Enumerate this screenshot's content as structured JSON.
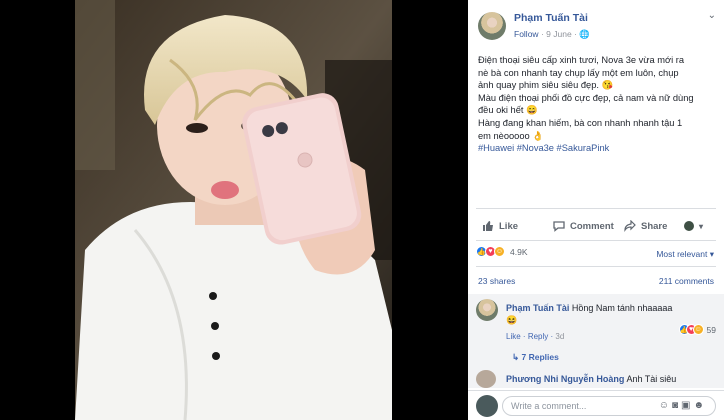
{
  "post": {
    "author": "Phạm Tuấn Tài",
    "follow": "Follow",
    "dot": "·",
    "date": "9 June",
    "caption_lines": [
      "Điện thoại siêu cấp xinh tươi, Nova 3e vừa mới ra",
      "nè bà con nhanh tay chụp lấy một em luôn, chụp",
      "ảnh quay phim siêu siêu đẹp. 😘",
      "Màu điện thoại phối đồ cực đẹp, cả nam và nữ dùng",
      "đều oki hết 😄",
      "Hàng đang khan hiếm, bà con nhanh nhanh tậu 1",
      "em nèooooo 👌"
    ],
    "hashtags": "#Huawei #Nova3e #SakuraPink"
  },
  "actions": {
    "like": "Like",
    "comment": "Comment",
    "share": "Share"
  },
  "reactions": {
    "count": "4.9K",
    "sort": "Most relevant"
  },
  "stats": {
    "shares": "23 shares",
    "comments": "211 comments"
  },
  "comment1": {
    "author": "Phạm Tuấn Tài",
    "text": "Hồng Nam tánh nhaaaaa",
    "emoji": "😆",
    "like": "Like",
    "reply": "Reply",
    "dot": "·",
    "age": "3d",
    "reaction_count": "59",
    "replies": "7 Replies"
  },
  "comment2": {
    "author": "Phương Nhi Nguyễn Hoàng",
    "text": "Anh Tài siêu"
  },
  "composer": {
    "placeholder": "Write a comment..."
  },
  "colors": {
    "link": "#365899",
    "like_blue": "#1877f2",
    "love_red": "#f33e58",
    "haha_yellow": "#f7b125"
  },
  "icons": [
    "globe-icon",
    "chevron-down-icon",
    "like-icon",
    "comment-icon",
    "share-icon",
    "emoji-icon",
    "camera-icon",
    "gif-icon",
    "sticker-icon"
  ]
}
